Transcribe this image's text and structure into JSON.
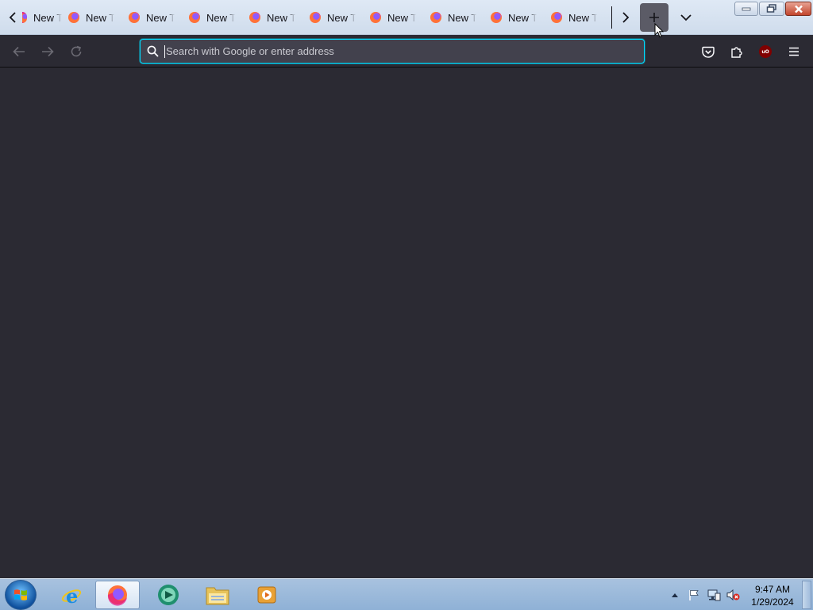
{
  "browser": {
    "tabs": [
      {
        "title": "New Tab"
      },
      {
        "title": "New Tab"
      },
      {
        "title": "New Tab"
      },
      {
        "title": "New Tab"
      },
      {
        "title": "New Tab"
      },
      {
        "title": "New Tab"
      },
      {
        "title": "New Tab"
      },
      {
        "title": "New Tab"
      },
      {
        "title": "New Tab"
      },
      {
        "title": "New Tab"
      }
    ],
    "urlbar": {
      "placeholder": "Search with Google or enter address",
      "value": ""
    },
    "toolbar": {
      "ublock_badge": "uO"
    },
    "accent_color": "#00ddff"
  },
  "taskbar": {
    "pinned": [
      "internet-explorer",
      "firefox",
      "media-app",
      "file-explorer",
      "media-player"
    ],
    "active": "firefox",
    "clock": {
      "time": "9:47 AM",
      "date": "1/29/2024"
    }
  }
}
